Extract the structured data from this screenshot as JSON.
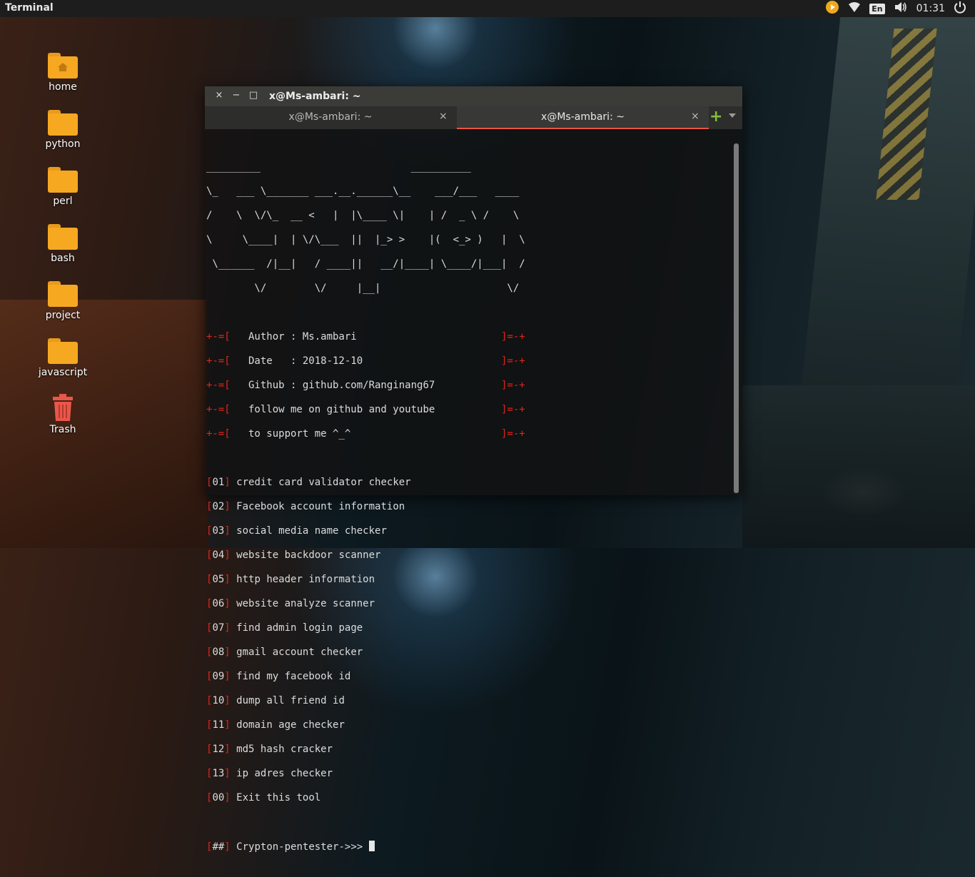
{
  "topbar": {
    "app_name": "Terminal",
    "language": "En",
    "clock": "01:31"
  },
  "desktop_icons": [
    {
      "label": "home"
    },
    {
      "label": "python"
    },
    {
      "label": "perl"
    },
    {
      "label": "bash"
    },
    {
      "label": "project"
    },
    {
      "label": "javascript"
    },
    {
      "label": "Trash"
    }
  ],
  "window": {
    "title": "x@Ms-ambari: ~",
    "close_glyph": "×",
    "minimize_glyph": "−",
    "maximize_glyph": "□",
    "tabs": [
      {
        "label": "x@Ms-ambari: ~",
        "close": "×"
      },
      {
        "label": "x@Ms-ambari: ~",
        "close": "×"
      }
    ],
    "new_tab": "+"
  },
  "terminal": {
    "banner": [
      "_________                         __________",
      "\\_   ___ \\_______ ___.__.______\\__    ___/___   ____",
      "/    \\  \\/\\_  __ <   |  |\\____ \\|    | /  _ \\ /    \\",
      "\\     \\____|  | \\/\\___  ||  |_> >    |(  <_> )   |  \\",
      " \\______  /|__|   / ____||   __/|____| \\____/|___|  /",
      "        \\/        \\/     |__|                     \\/"
    ],
    "info_prefix": "+-=[",
    "info_suffix": "]=-+",
    "info": [
      "   Author : Ms.ambari                        ",
      "   Date   : 2018-12-10                       ",
      "   Github : github.com/Ranginang67           ",
      "   follow me on github and youtube           ",
      "   to support me ^_^                         "
    ],
    "menu": [
      {
        "num": "01",
        "text": "credit card validator checker"
      },
      {
        "num": "02",
        "text": "Facebook account information"
      },
      {
        "num": "03",
        "text": "social media name checker"
      },
      {
        "num": "04",
        "text": "website backdoor scanner"
      },
      {
        "num": "05",
        "text": "http header information"
      },
      {
        "num": "06",
        "text": "website analyze scanner"
      },
      {
        "num": "07",
        "text": "find admin login page"
      },
      {
        "num": "08",
        "text": "gmail account checker"
      },
      {
        "num": "09",
        "text": "find my facebook id"
      },
      {
        "num": "10",
        "text": "dump all friend id"
      },
      {
        "num": "11",
        "text": "domain age checker"
      },
      {
        "num": "12",
        "text": "md5 hash cracker"
      },
      {
        "num": "13",
        "text": "ip adres checker"
      },
      {
        "num": "00",
        "text": "Exit this tool"
      }
    ],
    "prompt_tag": "##",
    "prompt_text": "Crypton-pentester->>> "
  },
  "colors": {
    "accent_red": "#e0251b",
    "tab_active_underline": "#e9553f",
    "folder_orange": "#f7a821"
  }
}
